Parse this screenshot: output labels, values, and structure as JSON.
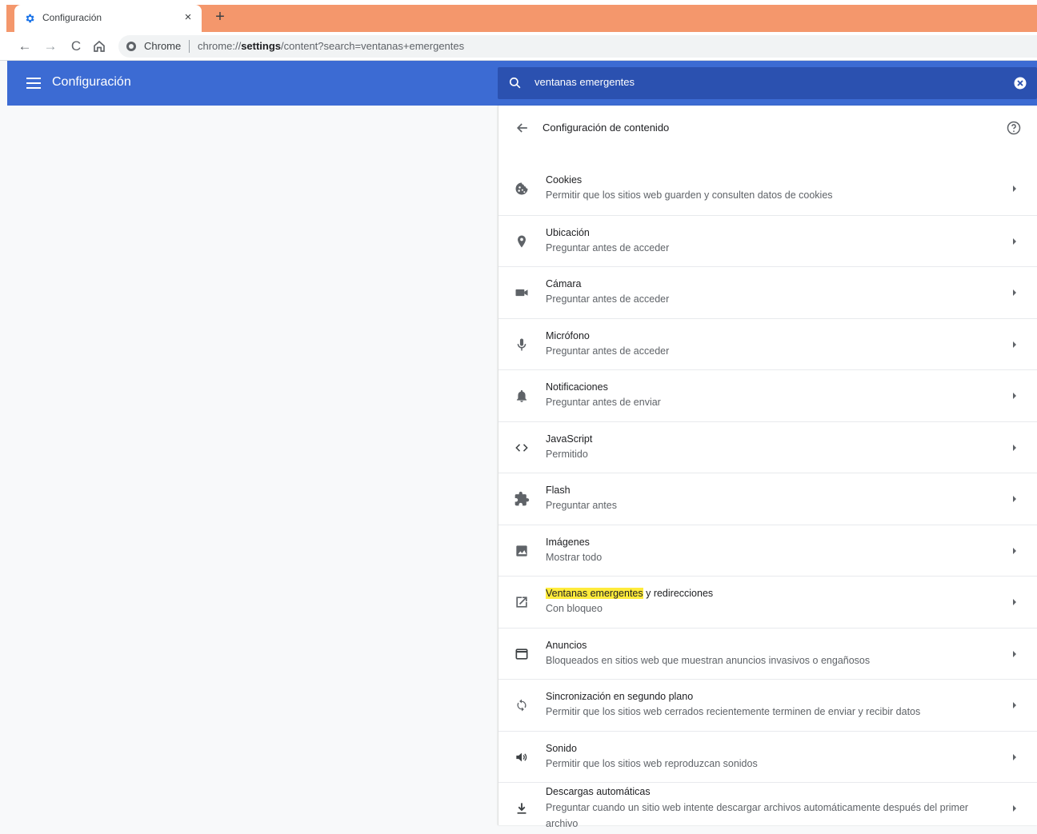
{
  "browser": {
    "tab_title": "Configuración",
    "tab_close": "×",
    "new_tab": "+",
    "omnibox_chip": "Chrome",
    "url_prefix": "chrome://",
    "url_bold": "settings",
    "url_suffix": "/content?search=ventanas+emergentes"
  },
  "header": {
    "title": "Configuración",
    "search_value": "ventanas emergentes"
  },
  "panel": {
    "title": "Configuración de contenido",
    "items": [
      {
        "title": "Cookies",
        "subtitle": "Permitir que los sitios web guarden y consulten datos de cookies",
        "icon": "cookie-icon"
      },
      {
        "title": "Ubicación",
        "subtitle": "Preguntar antes de acceder",
        "icon": "location-pin-icon"
      },
      {
        "title": "Cámara",
        "subtitle": "Preguntar antes de acceder",
        "icon": "camera-icon"
      },
      {
        "title": "Micrófono",
        "subtitle": "Preguntar antes de acceder",
        "icon": "microphone-icon"
      },
      {
        "title": "Notificaciones",
        "subtitle": "Preguntar antes de enviar",
        "icon": "bell-icon"
      },
      {
        "title": "JavaScript",
        "subtitle": "Permitido",
        "icon": "code-icon"
      },
      {
        "title": "Flash",
        "subtitle": "Preguntar antes",
        "icon": "puzzle-icon"
      },
      {
        "title": "Imágenes",
        "subtitle": "Mostrar todo",
        "icon": "image-icon"
      },
      {
        "title_highlight": "Ventanas emergentes",
        "title_rest": " y redirecciones",
        "subtitle": "Con bloqueo",
        "icon": "open-in-new-icon"
      },
      {
        "title": "Anuncios",
        "subtitle": "Bloqueados en sitios web que muestran anuncios invasivos o engañosos",
        "icon": "window-icon"
      },
      {
        "title": "Sincronización en segundo plano",
        "subtitle": "Permitir que los sitios web cerrados recientemente terminen de enviar y recibir datos",
        "icon": "sync-icon"
      },
      {
        "title": "Sonido",
        "subtitle": "Permitir que los sitios web reproduzcan sonidos",
        "icon": "speaker-icon"
      },
      {
        "title": "Descargas automáticas",
        "subtitle": "Preguntar cuando un sitio web intente descargar archivos automáticamente después del primer archivo",
        "icon": "download-icon"
      }
    ]
  },
  "colors": {
    "header_blue": "#3c6bd3",
    "search_blue": "#2b51b0",
    "tab_accent": "#f4976c",
    "highlight": "#ffeb3b"
  }
}
